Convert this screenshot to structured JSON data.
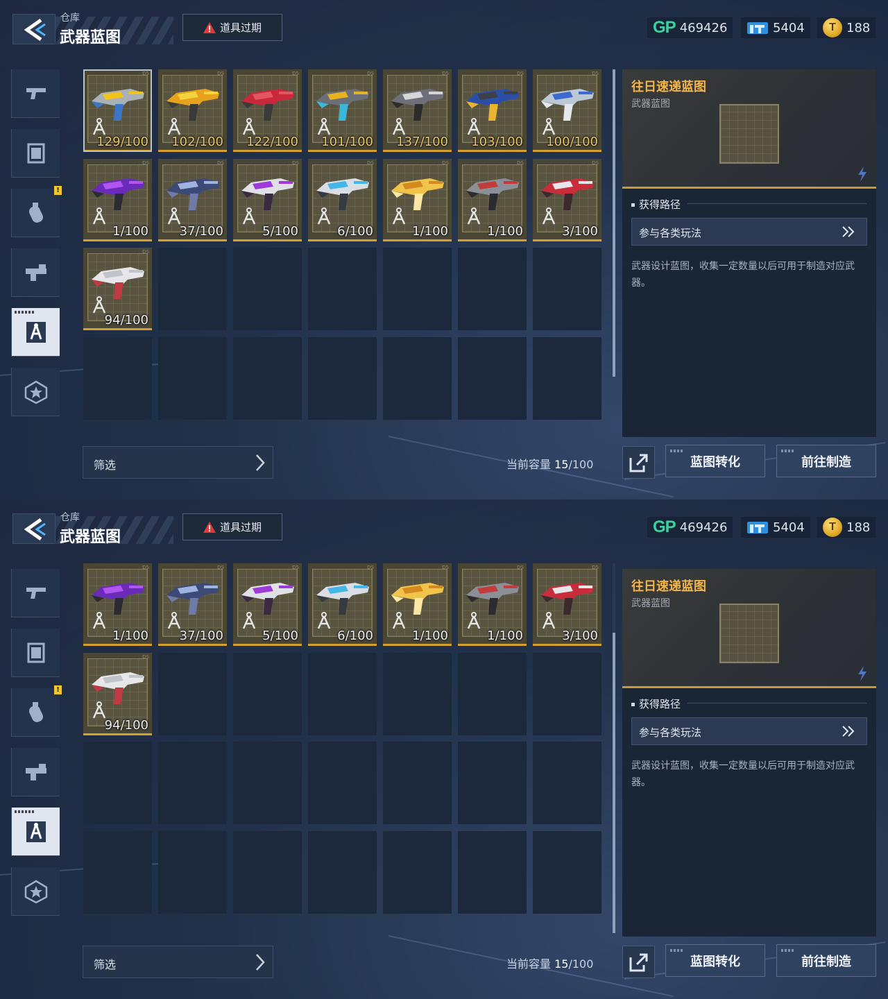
{
  "header": {
    "breadcrumb": "仓库",
    "title": "武器蓝图",
    "expire_button": "道具过期"
  },
  "currencies": [
    {
      "icon": "gp-icon",
      "label": "GP",
      "value": "469426"
    },
    {
      "icon": "pipe-currency-icon",
      "value": "5404"
    },
    {
      "icon": "gold-coin-icon",
      "value": "188"
    }
  ],
  "sidebar": {
    "tabs": [
      {
        "icon": "pistol-icon",
        "active": false
      },
      {
        "icon": "frame-icon",
        "active": false
      },
      {
        "icon": "grenade-icon",
        "active": false,
        "notification": "!"
      },
      {
        "icon": "attachment-icon",
        "active": false
      },
      {
        "icon": "blueprint-icon",
        "active": true
      },
      {
        "icon": "star-badge-icon",
        "active": false
      }
    ]
  },
  "items": [
    {
      "count": "129/100",
      "colors": [
        "#a9b0b8",
        "#f0c419",
        "#3a77c7"
      ]
    },
    {
      "count": "102/100",
      "colors": [
        "#e6a21e",
        "#f4d33c",
        "#3a3a3a"
      ]
    },
    {
      "count": "122/100",
      "colors": [
        "#c8283a",
        "#e25563",
        "#3a3a3a"
      ]
    },
    {
      "count": "101/100",
      "colors": [
        "#6b6f78",
        "#e7b321",
        "#3cb6d9"
      ]
    },
    {
      "count": "137/100",
      "colors": [
        "#6d7079",
        "#d4d6da",
        "#2c2c2c"
      ]
    },
    {
      "count": "103/100",
      "colors": [
        "#2b4ea8",
        "#3f3f47",
        "#e9b430"
      ]
    },
    {
      "count": "100/100",
      "colors": [
        "#bcc8d6",
        "#3b6ad0",
        "#e5e8ec"
      ]
    },
    {
      "count": "1/100",
      "colors": [
        "#6a2bb8",
        "#b155f0",
        "#2b2b35"
      ]
    },
    {
      "count": "37/100",
      "colors": [
        "#3c4a78",
        "#9fb2e0",
        "#6e7aa8"
      ]
    },
    {
      "count": "5/100",
      "colors": [
        "#dfe1e6",
        "#9d3ad8",
        "#3a2a44"
      ]
    },
    {
      "count": "6/100",
      "colors": [
        "#d9dde4",
        "#44b7e8",
        "#363a42"
      ]
    },
    {
      "count": "1/100",
      "colors": [
        "#f0c44a",
        "#d48a1f",
        "#fbe7a1"
      ]
    },
    {
      "count": "1/100",
      "colors": [
        "#8a8f98",
        "#c33b3b",
        "#2a2c30"
      ]
    },
    {
      "count": "3/100",
      "colors": [
        "#c92c3a",
        "#e7e7ea",
        "#3a2a2e"
      ]
    },
    {
      "count": "94/100",
      "colors": [
        "#e7e7ea",
        "#c0c3c9",
        "#c03a44"
      ]
    }
  ],
  "footer": {
    "filter_label": "筛选",
    "capacity_label": "当前容量",
    "capacity_used": "15",
    "capacity_total": "/100",
    "convert_button": "蓝图转化",
    "craft_button": "前往制造"
  },
  "detail": {
    "name": "往日速递蓝图",
    "type": "武器蓝图",
    "source_title": "获得路径",
    "source_button": "参与各类玩法",
    "description": "武器设计蓝图，收集一定数量以后可用于制造对应武器。"
  },
  "colors": {
    "accent_gold": "#f3b64a",
    "gp_green": "#3ad29f",
    "slot_border_gold": "#d4a02e"
  }
}
